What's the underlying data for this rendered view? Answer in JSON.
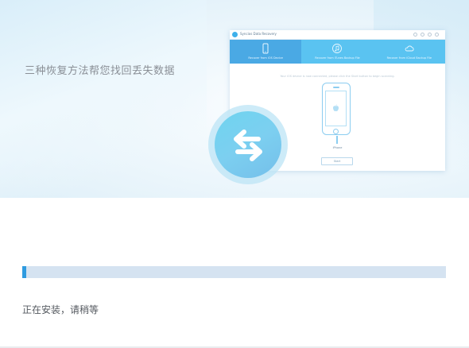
{
  "banner": {
    "tagline": "三种恢复方法帮您找回丢失数据"
  },
  "mockup": {
    "app_name": "Syncios Data Recovery",
    "tabs": [
      {
        "label": "Recover from iOS Device",
        "icon": "phone-icon",
        "active": true
      },
      {
        "label": "Recover from iTunes Backup File",
        "icon": "music-note-icon",
        "active": false
      },
      {
        "label": "Recover from iCloud Backup File",
        "icon": "cloud-icon",
        "active": false
      }
    ],
    "hint": "Your iOS device is now connected, please click the Start button to begin scanning.",
    "device_name": "iPhone",
    "start_label": "Start"
  },
  "sync_badge": {
    "icon": "sync-arrows-icon"
  },
  "installer": {
    "progress": 0.01,
    "status_text": "正在安装，请稍等"
  },
  "colors": {
    "accent": "#2f9be0",
    "progress_track": "#d5e3f1",
    "mock_tab_bar": "#5ac3f1"
  }
}
